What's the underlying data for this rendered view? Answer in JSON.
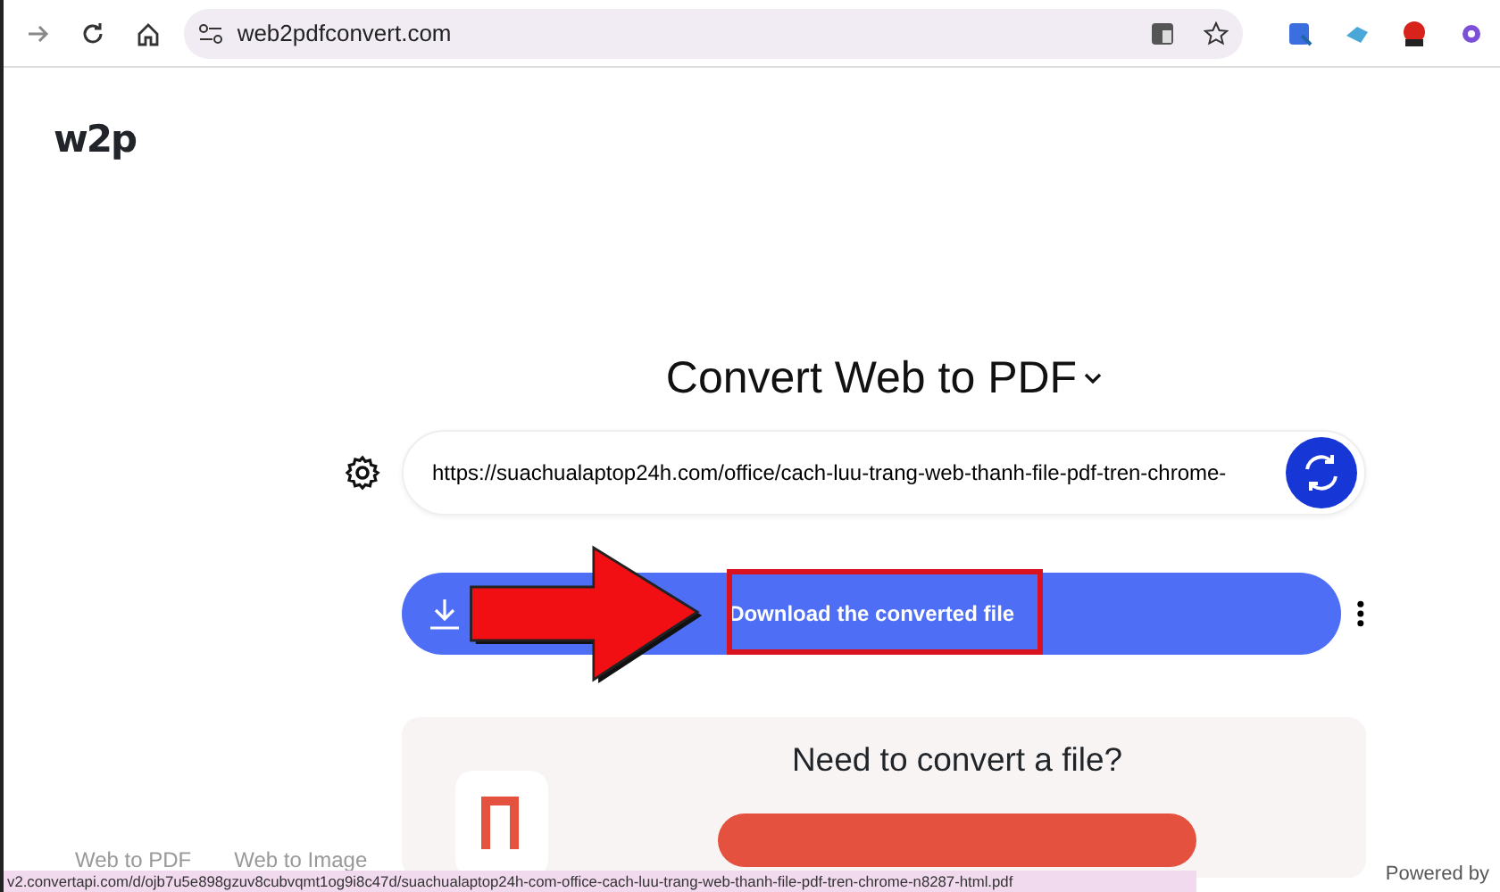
{
  "browser": {
    "address": "web2pdfconvert.com"
  },
  "logo": "w2p",
  "title": "Convert Web to PDF",
  "url_field": {
    "value": "https://suachualaptop24h.com/office/cach-luu-trang-web-thanh-file-pdf-tren-chrome-"
  },
  "download_button": "Download the converted file",
  "promo": {
    "heading": "Need to convert a file?"
  },
  "footer_links": [
    "Web to PDF",
    "Web to Image"
  ],
  "powered_by": "Powered by",
  "status_bar": "v2.convertapi.com/d/ojb7u5e898gzuv8cubvqmt1og9i8c47d/suachualaptop24h-com-office-cach-luu-trang-web-thanh-file-pdf-tren-chrome-n8287-html.pdf"
}
